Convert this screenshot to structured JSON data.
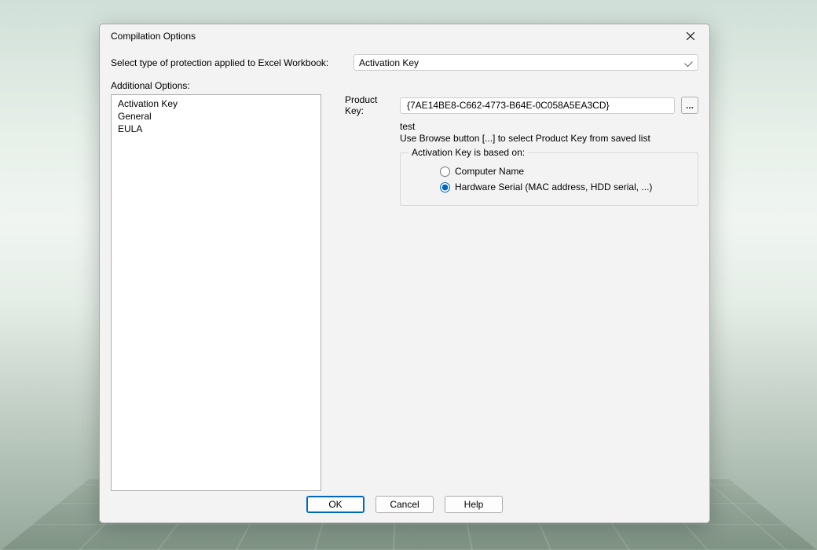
{
  "dialog": {
    "title": "Compilation Options"
  },
  "protection": {
    "label": "Select type of protection applied to Excel Workbook:",
    "selected": "Activation Key"
  },
  "additional": {
    "label": "Additional Options:",
    "items": [
      "Activation Key",
      "General",
      "EULA"
    ]
  },
  "productKey": {
    "label": "Product Key:",
    "value": "{7AE14BE8-C662-4773-B64E-0C058A5EA3CD}",
    "browse": "...",
    "hint1": "test",
    "hint2": "Use Browse button [...] to select Product Key from saved list"
  },
  "activationBasis": {
    "legend": "Activation Key is based on:",
    "option1": "Computer Name",
    "option2": "Hardware Serial (MAC address, HDD serial, ...)",
    "selected": "hardware"
  },
  "buttons": {
    "ok": "OK",
    "cancel": "Cancel",
    "help": "Help"
  }
}
